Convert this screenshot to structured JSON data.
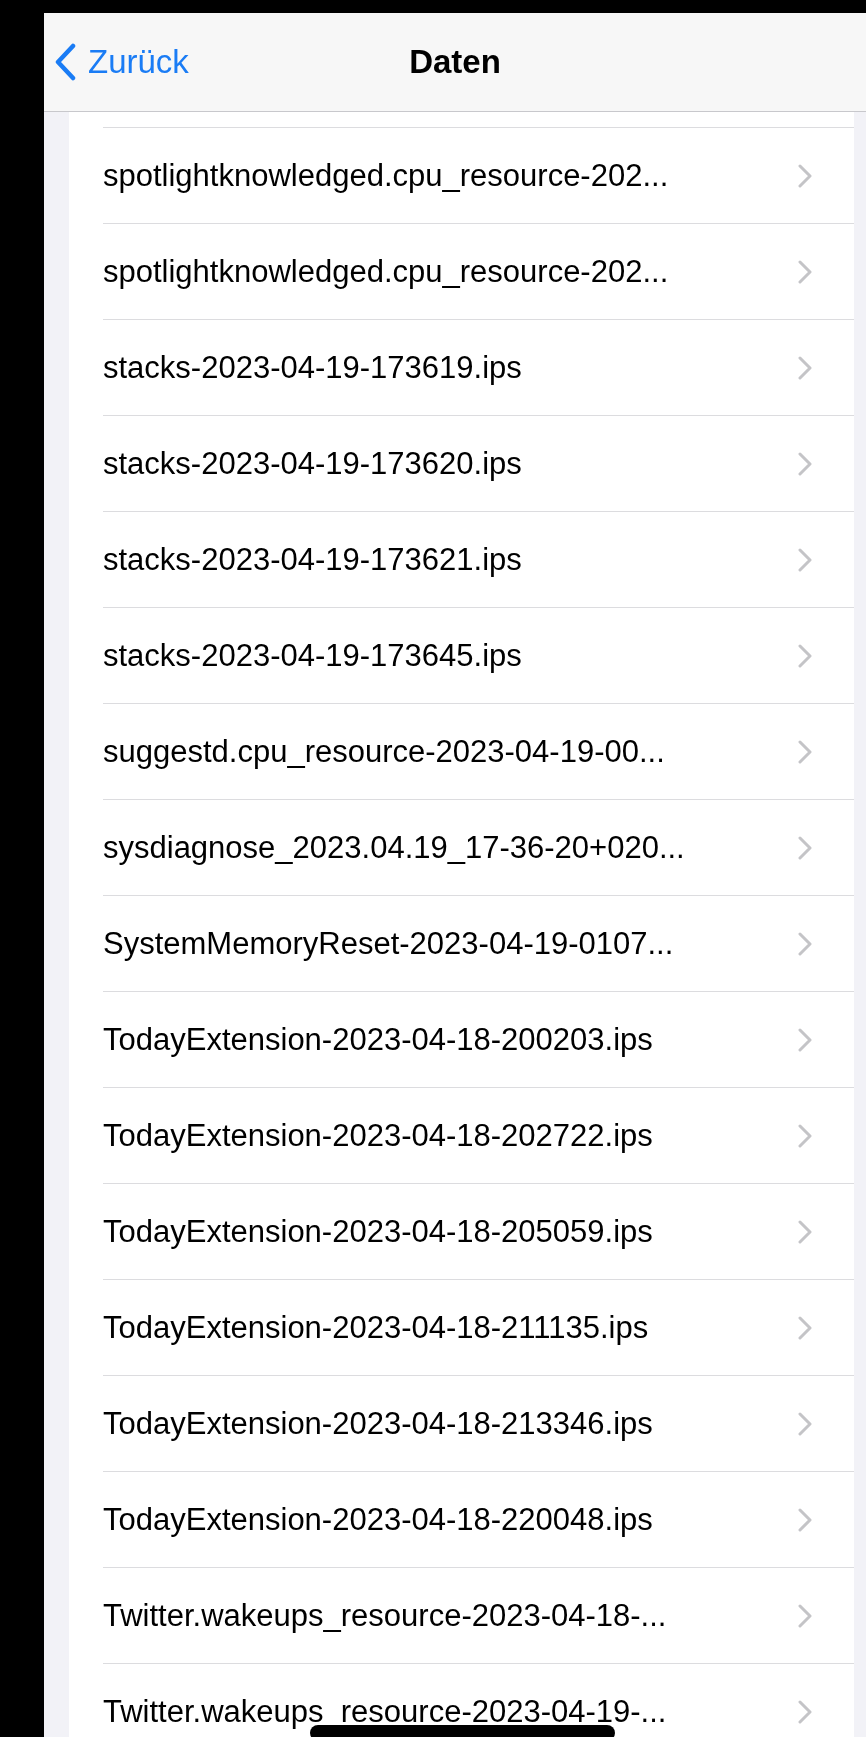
{
  "nav": {
    "back": "Zurück",
    "title": "Daten"
  },
  "files": [
    "spotlightknowledged.cpu_resource-202...",
    "spotlightknowledged.cpu_resource-202...",
    "stacks-2023-04-19-173619.ips",
    "stacks-2023-04-19-173620.ips",
    "stacks-2023-04-19-173621.ips",
    "stacks-2023-04-19-173645.ips",
    "suggestd.cpu_resource-2023-04-19-00...",
    "sysdiagnose_2023.04.19_17-36-20+020...",
    "SystemMemoryReset-2023-04-19-0107...",
    "TodayExtension-2023-04-18-200203.ips",
    "TodayExtension-2023-04-18-202722.ips",
    "TodayExtension-2023-04-18-205059.ips",
    "TodayExtension-2023-04-18-211135.ips",
    "TodayExtension-2023-04-18-213346.ips",
    "TodayExtension-2023-04-18-220048.ips",
    "Twitter.wakeups_resource-2023-04-18-...",
    "Twitter.wakeups_resource-2023-04-19-..."
  ]
}
